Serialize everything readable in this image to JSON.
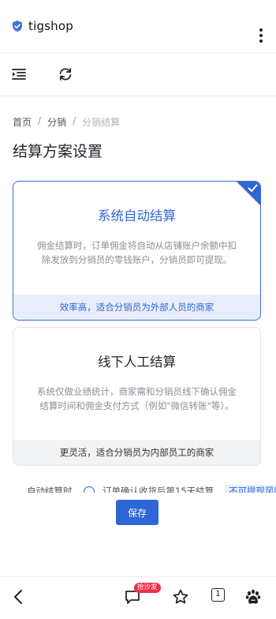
{
  "app": {
    "brand_name": "tigshop"
  },
  "breadcrumb": {
    "home": "首页",
    "sep": "/",
    "section": "分销",
    "current": "分销结算"
  },
  "page": {
    "title": "结算方案设置"
  },
  "options": [
    {
      "title": "系统自动结算",
      "description": "佣金结算时，订单佣金将自动从店铺账户余额中扣除发放到分销员的零钱账户，分销员即可提现。",
      "footer": "效率高，适合分销员为外部人员的商家",
      "selected": true
    },
    {
      "title": "线下人工结算",
      "description": "系统仅做业绩统计，商家需和分销员线下确认佣金结算时间和佣金支付方式（例如\"微信转账\"等）。",
      "footer": "更灵活，适合分销员为内部员工的商家",
      "selected": false
    }
  ],
  "partial_row": {
    "label": "自动结算时",
    "text": "订单确认收货后第15天結算",
    "tag": "不可提现风险"
  },
  "actions": {
    "save_label": "保存"
  },
  "bottom_nav": {
    "hot_badge": "抢沙发",
    "tab_count": "1"
  },
  "colors": {
    "accent": "#2f66d6",
    "selected_footer": "#e8eefb",
    "badge": "#f02d4b"
  },
  "icons": [
    "shield-check-icon",
    "kebab-menu-icon",
    "menu-indent-icon",
    "refresh-icon",
    "check-icon",
    "back-arrow-icon",
    "comment-icon",
    "star-icon",
    "tabs-icon",
    "paw-icon"
  ]
}
